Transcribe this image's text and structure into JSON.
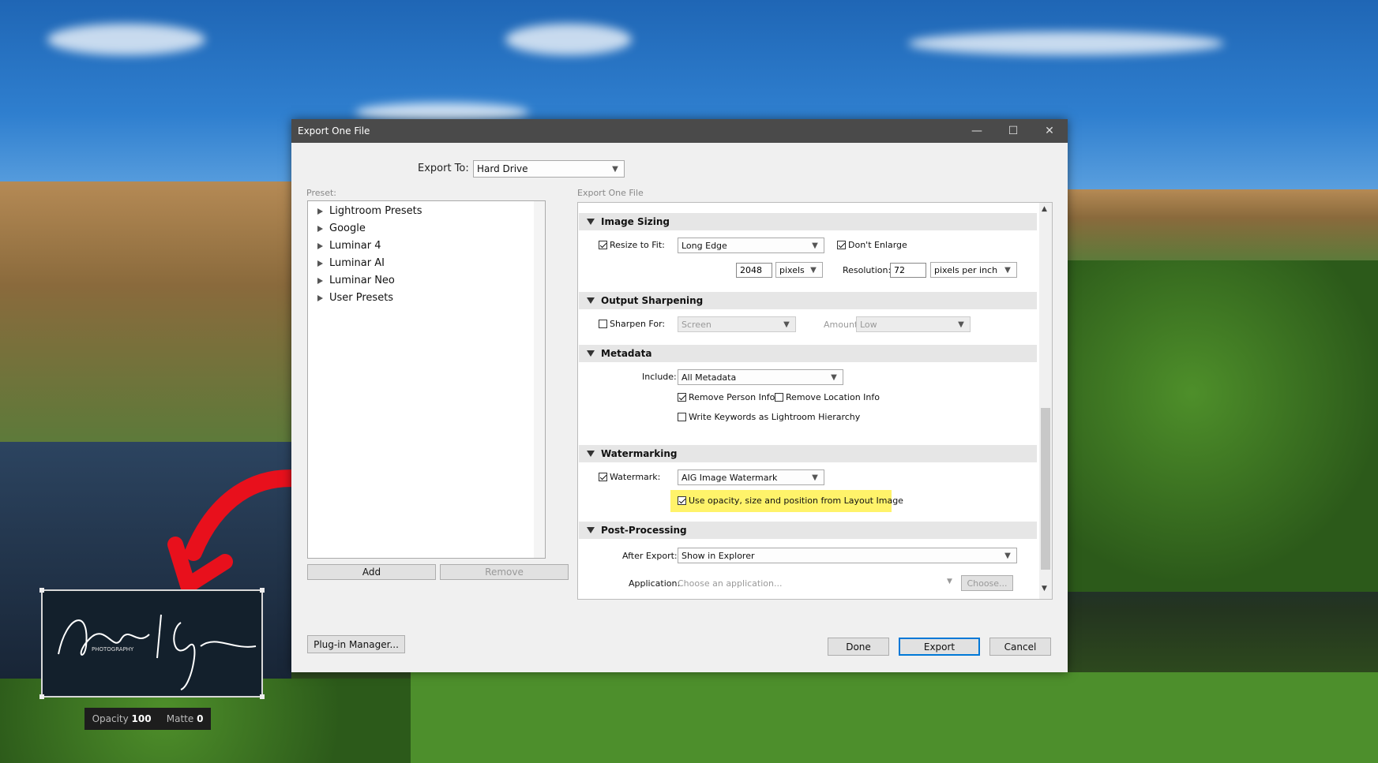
{
  "dialog": {
    "title": "Export One File",
    "export_to_label": "Export To:",
    "export_to_value": "Hard Drive",
    "preset_label": "Preset:",
    "panel_label": "Export One File",
    "presets": [
      "Lightroom Presets",
      "Google",
      "Luminar 4",
      "Luminar AI",
      "Luminar Neo",
      "User Presets"
    ],
    "add_label": "Add",
    "remove_label": "Remove",
    "plugin_manager_label": "Plug-in Manager...",
    "done_label": "Done",
    "export_label": "Export",
    "cancel_label": "Cancel"
  },
  "image_sizing": {
    "header": "Image Sizing",
    "resize_label": "Resize to Fit:",
    "resize_checked": true,
    "resize_mode": "Long Edge",
    "dont_enlarge_label": "Don't Enlarge",
    "dont_enlarge_checked": true,
    "size_value": "2048",
    "size_unit": "pixels",
    "resolution_label": "Resolution:",
    "resolution_value": "72",
    "resolution_unit": "pixels per inch"
  },
  "output_sharpening": {
    "header": "Output Sharpening",
    "sharpen_label": "Sharpen For:",
    "sharpen_checked": false,
    "sharpen_value": "Screen",
    "amount_label": "Amount:",
    "amount_value": "Low"
  },
  "metadata": {
    "header": "Metadata",
    "include_label": "Include:",
    "include_value": "All Metadata",
    "remove_person_label": "Remove Person Info",
    "remove_person_checked": true,
    "remove_location_label": "Remove Location Info",
    "remove_location_checked": false,
    "write_keywords_label": "Write Keywords as Lightroom Hierarchy",
    "write_keywords_checked": false
  },
  "watermarking": {
    "header": "Watermarking",
    "watermark_label": "Watermark:",
    "watermark_checked": true,
    "watermark_value": "AIG Image Watermark",
    "use_layout_label": "Use opacity, size and position from Layout Image",
    "use_layout_checked": true,
    "highlight_color": "#fff36a"
  },
  "post_processing": {
    "header": "Post-Processing",
    "after_export_label": "After Export:",
    "after_export_value": "Show in Explorer",
    "application_label": "Application:",
    "application_placeholder": "Choose an application...",
    "choose_label": "Choose..."
  },
  "overlay": {
    "arrow_color": "#e8101c",
    "opacity_label": "Opacity",
    "opacity_value": "100",
    "matte_label": "Matte",
    "matte_value": "0"
  }
}
